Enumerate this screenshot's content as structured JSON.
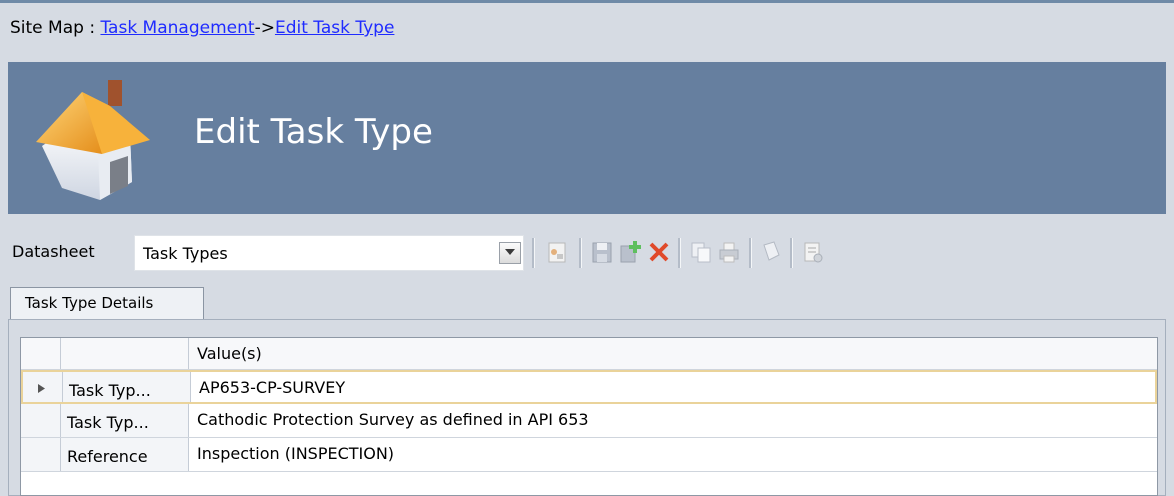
{
  "breadcrumb": {
    "prefix": "Site Map : ",
    "link1": "Task Management",
    "separator": "->",
    "link2": "Edit Task Type"
  },
  "banner": {
    "title": "Edit Task Type",
    "icon": "home-icon"
  },
  "toolbar": {
    "datasheet_label": "Datasheet",
    "datasheet_value": "Task Types",
    "icons": [
      "new-icon",
      "save-icon",
      "add-icon",
      "delete-icon",
      "copy-icon",
      "print-icon",
      "refresh-icon",
      "clipboard-icon"
    ]
  },
  "tabs": [
    {
      "label": "Task Type Details"
    }
  ],
  "grid": {
    "header": {
      "value_col": "Value(s)"
    },
    "rows": [
      {
        "key": "Task Typ...",
        "value": "AP653-CP-SURVEY",
        "current": true
      },
      {
        "key": "Task Typ...",
        "value": "Cathodic Protection Survey as defined in API 653"
      },
      {
        "key": "Reference",
        "value": "Inspection (INSPECTION)"
      }
    ]
  },
  "colors": {
    "banner": "#667f9f",
    "link": "#1f2bff",
    "delete_icon": "#e04a2a"
  }
}
